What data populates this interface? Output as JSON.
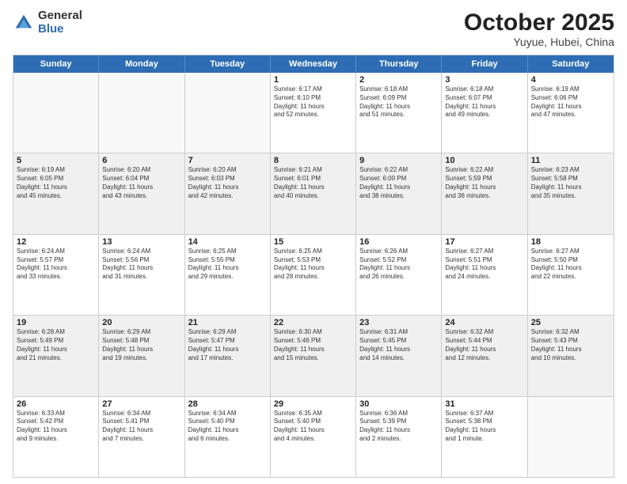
{
  "header": {
    "logo_general": "General",
    "logo_blue": "Blue",
    "month": "October 2025",
    "location": "Yuyue, Hubei, China"
  },
  "weekdays": [
    "Sunday",
    "Monday",
    "Tuesday",
    "Wednesday",
    "Thursday",
    "Friday",
    "Saturday"
  ],
  "rows": [
    [
      {
        "day": "",
        "info": "",
        "empty": true
      },
      {
        "day": "",
        "info": "",
        "empty": true
      },
      {
        "day": "",
        "info": "",
        "empty": true
      },
      {
        "day": "1",
        "info": "Sunrise: 6:17 AM\nSunset: 6:10 PM\nDaylight: 11 hours\nand 52 minutes."
      },
      {
        "day": "2",
        "info": "Sunrise: 6:18 AM\nSunset: 6:09 PM\nDaylight: 11 hours\nand 51 minutes."
      },
      {
        "day": "3",
        "info": "Sunrise: 6:18 AM\nSunset: 6:07 PM\nDaylight: 11 hours\nand 49 minutes."
      },
      {
        "day": "4",
        "info": "Sunrise: 6:19 AM\nSunset: 6:06 PM\nDaylight: 11 hours\nand 47 minutes."
      }
    ],
    [
      {
        "day": "5",
        "info": "Sunrise: 6:19 AM\nSunset: 6:05 PM\nDaylight: 11 hours\nand 45 minutes.",
        "shaded": true
      },
      {
        "day": "6",
        "info": "Sunrise: 6:20 AM\nSunset: 6:04 PM\nDaylight: 11 hours\nand 43 minutes.",
        "shaded": true
      },
      {
        "day": "7",
        "info": "Sunrise: 6:20 AM\nSunset: 6:03 PM\nDaylight: 11 hours\nand 42 minutes.",
        "shaded": true
      },
      {
        "day": "8",
        "info": "Sunrise: 6:21 AM\nSunset: 6:01 PM\nDaylight: 11 hours\nand 40 minutes.",
        "shaded": true
      },
      {
        "day": "9",
        "info": "Sunrise: 6:22 AM\nSunset: 6:00 PM\nDaylight: 11 hours\nand 38 minutes.",
        "shaded": true
      },
      {
        "day": "10",
        "info": "Sunrise: 6:22 AM\nSunset: 5:59 PM\nDaylight: 11 hours\nand 36 minutes.",
        "shaded": true
      },
      {
        "day": "11",
        "info": "Sunrise: 6:23 AM\nSunset: 5:58 PM\nDaylight: 11 hours\nand 35 minutes.",
        "shaded": true
      }
    ],
    [
      {
        "day": "12",
        "info": "Sunrise: 6:24 AM\nSunset: 5:57 PM\nDaylight: 11 hours\nand 33 minutes."
      },
      {
        "day": "13",
        "info": "Sunrise: 6:24 AM\nSunset: 5:56 PM\nDaylight: 11 hours\nand 31 minutes."
      },
      {
        "day": "14",
        "info": "Sunrise: 6:25 AM\nSunset: 5:55 PM\nDaylight: 11 hours\nand 29 minutes."
      },
      {
        "day": "15",
        "info": "Sunrise: 6:25 AM\nSunset: 5:53 PM\nDaylight: 11 hours\nand 28 minutes."
      },
      {
        "day": "16",
        "info": "Sunrise: 6:26 AM\nSunset: 5:52 PM\nDaylight: 11 hours\nand 26 minutes."
      },
      {
        "day": "17",
        "info": "Sunrise: 6:27 AM\nSunset: 5:51 PM\nDaylight: 11 hours\nand 24 minutes."
      },
      {
        "day": "18",
        "info": "Sunrise: 6:27 AM\nSunset: 5:50 PM\nDaylight: 11 hours\nand 22 minutes."
      }
    ],
    [
      {
        "day": "19",
        "info": "Sunrise: 6:28 AM\nSunset: 5:49 PM\nDaylight: 11 hours\nand 21 minutes.",
        "shaded": true
      },
      {
        "day": "20",
        "info": "Sunrise: 6:29 AM\nSunset: 5:48 PM\nDaylight: 11 hours\nand 19 minutes.",
        "shaded": true
      },
      {
        "day": "21",
        "info": "Sunrise: 6:29 AM\nSunset: 5:47 PM\nDaylight: 11 hours\nand 17 minutes.",
        "shaded": true
      },
      {
        "day": "22",
        "info": "Sunrise: 6:30 AM\nSunset: 5:46 PM\nDaylight: 11 hours\nand 15 minutes.",
        "shaded": true
      },
      {
        "day": "23",
        "info": "Sunrise: 6:31 AM\nSunset: 5:45 PM\nDaylight: 11 hours\nand 14 minutes.",
        "shaded": true
      },
      {
        "day": "24",
        "info": "Sunrise: 6:32 AM\nSunset: 5:44 PM\nDaylight: 11 hours\nand 12 minutes.",
        "shaded": true
      },
      {
        "day": "25",
        "info": "Sunrise: 6:32 AM\nSunset: 5:43 PM\nDaylight: 11 hours\nand 10 minutes.",
        "shaded": true
      }
    ],
    [
      {
        "day": "26",
        "info": "Sunrise: 6:33 AM\nSunset: 5:42 PM\nDaylight: 11 hours\nand 9 minutes."
      },
      {
        "day": "27",
        "info": "Sunrise: 6:34 AM\nSunset: 5:41 PM\nDaylight: 11 hours\nand 7 minutes."
      },
      {
        "day": "28",
        "info": "Sunrise: 6:34 AM\nSunset: 5:40 PM\nDaylight: 11 hours\nand 6 minutes."
      },
      {
        "day": "29",
        "info": "Sunrise: 6:35 AM\nSunset: 5:40 PM\nDaylight: 11 hours\nand 4 minutes."
      },
      {
        "day": "30",
        "info": "Sunrise: 6:36 AM\nSunset: 5:39 PM\nDaylight: 11 hours\nand 2 minutes."
      },
      {
        "day": "31",
        "info": "Sunrise: 6:37 AM\nSunset: 5:38 PM\nDaylight: 11 hours\nand 1 minute."
      },
      {
        "day": "",
        "info": "",
        "empty": true
      }
    ]
  ]
}
